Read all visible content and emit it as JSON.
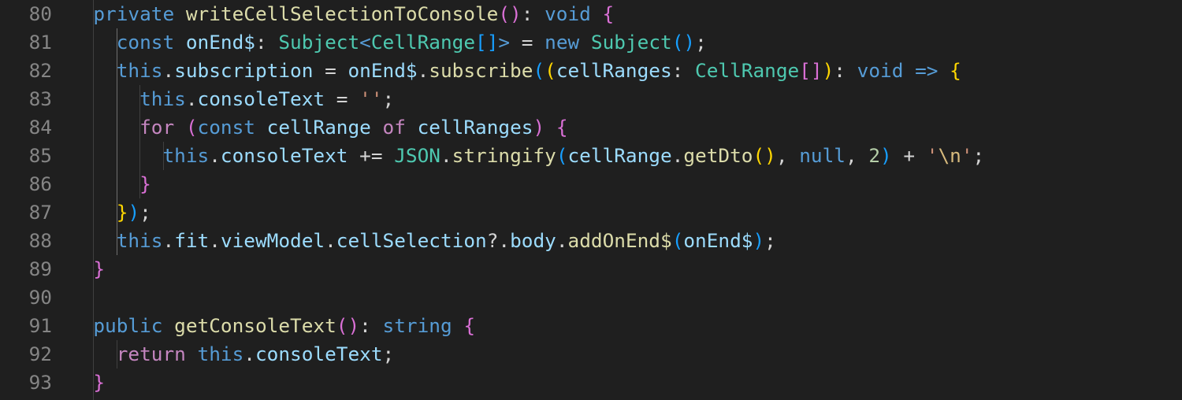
{
  "editor": {
    "language": "typescript",
    "lines": [
      {
        "number": "80",
        "text": "  private writeCellSelectionToConsole(): void {"
      },
      {
        "number": "81",
        "text": "    const onEnd$: Subject<CellRange[]> = new Subject();"
      },
      {
        "number": "82",
        "text": "    this.subscription = onEnd$.subscribe((cellRanges: CellRange[]): void => {"
      },
      {
        "number": "83",
        "text": "      this.consoleText = '';"
      },
      {
        "number": "84",
        "text": "      for (const cellRange of cellRanges) {"
      },
      {
        "number": "85",
        "text": "        this.consoleText += JSON.stringify(cellRange.getDto(), null, 2) + '\\n';"
      },
      {
        "number": "86",
        "text": "      }"
      },
      {
        "number": "87",
        "text": "    });"
      },
      {
        "number": "88",
        "text": "    this.fit.viewModel.cellSelection?.body.addOnEnd$(onEnd$);"
      },
      {
        "number": "89",
        "text": "  }"
      },
      {
        "number": "90",
        "text": ""
      },
      {
        "number": "91",
        "text": "  public getConsoleText(): string {"
      },
      {
        "number": "92",
        "text": "    return this.consoleText;"
      },
      {
        "number": "93",
        "text": "  }"
      }
    ]
  },
  "colors": {
    "background": "#1f1f1f",
    "line_number": "#858585",
    "keyword": "#569cd6",
    "control": "#c586c0",
    "function": "#dcdcaa",
    "variable": "#9cdcfe",
    "type": "#4ec9b0",
    "string": "#ce9178",
    "number": "#b5cea8",
    "bracket_1": "#ffd700",
    "bracket_2": "#da70d6",
    "bracket_3": "#179fff"
  }
}
